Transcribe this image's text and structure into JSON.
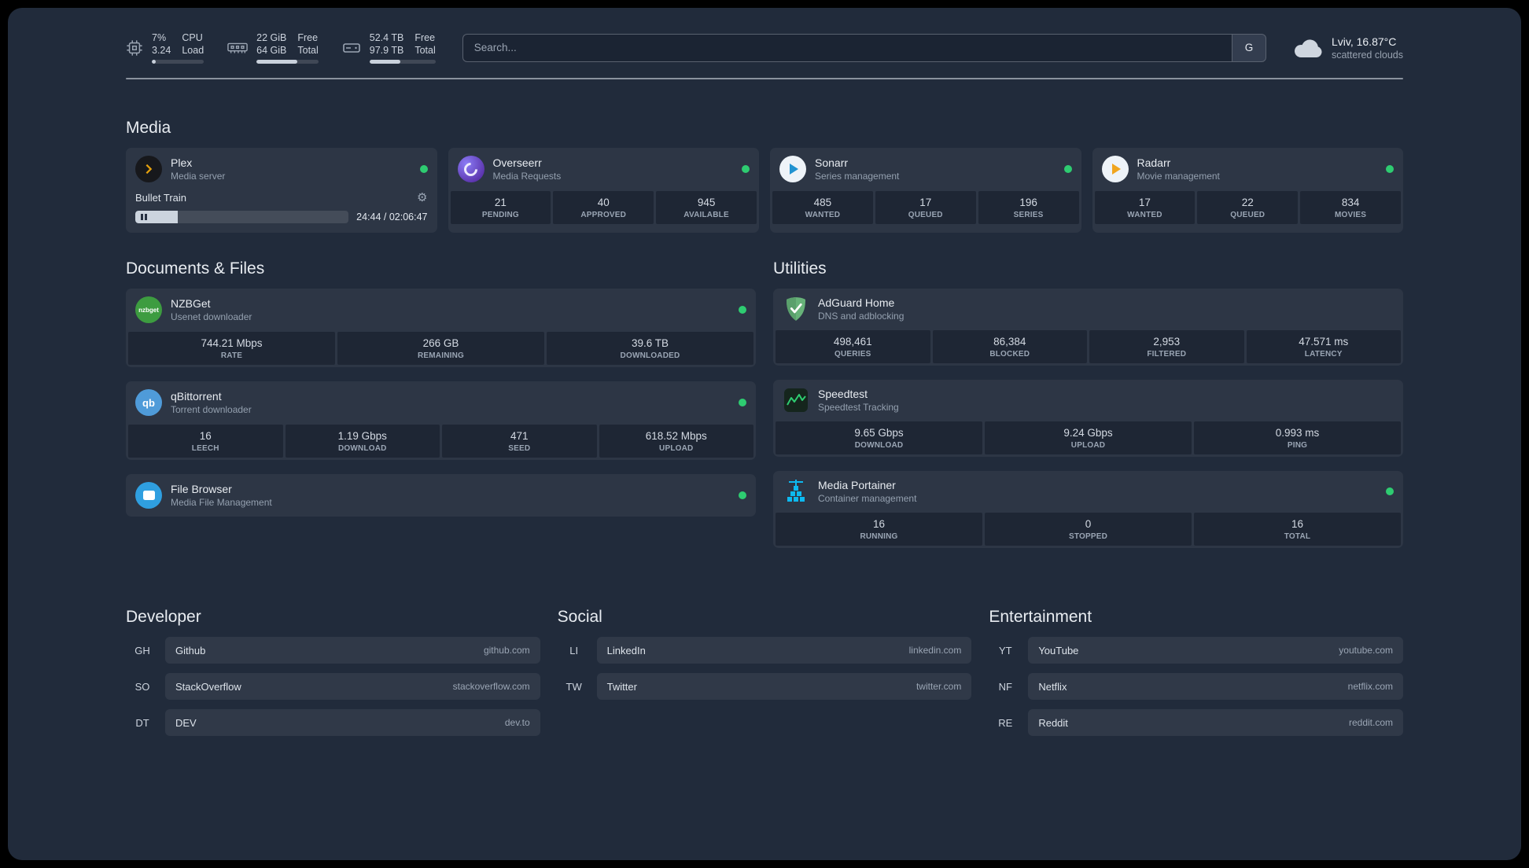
{
  "colors": {
    "status_online": "#2ecc71",
    "background": "#212b3b"
  },
  "topbar": {
    "resources": [
      {
        "icon": "cpu-icon",
        "line1_value": "7%",
        "line1_label": "CPU",
        "line2_value": "3.24",
        "line2_label": "Load",
        "bar_pct": 7
      },
      {
        "icon": "memory-icon",
        "line1_value": "22 GiB",
        "line1_label": "Free",
        "line2_value": "64 GiB",
        "line2_label": "Total",
        "bar_pct": 66
      },
      {
        "icon": "disk-icon",
        "line1_value": "52.4 TB",
        "line1_label": "Free",
        "line2_value": "97.9 TB",
        "line2_label": "Total",
        "bar_pct": 47
      }
    ],
    "search": {
      "placeholder": "Search...",
      "provider_button": "G"
    },
    "weather": {
      "location": "Lviv, 16.87°C",
      "condition": "scattered clouds"
    }
  },
  "sections": {
    "media": {
      "title": "Media",
      "plex": {
        "name": "Plex",
        "desc": "Media server",
        "now_playing": "Bullet Train",
        "time": "24:44 / 02:06:47",
        "progress_pct": 20
      },
      "overseerr": {
        "name": "Overseerr",
        "desc": "Media Requests",
        "stats": [
          {
            "value": "21",
            "label": "PENDING"
          },
          {
            "value": "40",
            "label": "APPROVED"
          },
          {
            "value": "945",
            "label": "AVAILABLE"
          }
        ]
      },
      "sonarr": {
        "name": "Sonarr",
        "desc": "Series management",
        "stats": [
          {
            "value": "485",
            "label": "WANTED"
          },
          {
            "value": "17",
            "label": "QUEUED"
          },
          {
            "value": "196",
            "label": "SERIES"
          }
        ]
      },
      "radarr": {
        "name": "Radarr",
        "desc": "Movie management",
        "stats": [
          {
            "value": "17",
            "label": "WANTED"
          },
          {
            "value": "22",
            "label": "QUEUED"
          },
          {
            "value": "834",
            "label": "MOVIES"
          }
        ]
      }
    },
    "documents": {
      "title": "Documents & Files",
      "nzbget": {
        "name": "NZBGet",
        "desc": "Usenet downloader",
        "stats": [
          {
            "value": "744.21 Mbps",
            "label": "RATE"
          },
          {
            "value": "266 GB",
            "label": "REMAINING"
          },
          {
            "value": "39.6 TB",
            "label": "DOWNLOADED"
          }
        ]
      },
      "qbittorrent": {
        "name": "qBittorrent",
        "desc": "Torrent downloader",
        "stats": [
          {
            "value": "16",
            "label": "LEECH"
          },
          {
            "value": "1.19 Gbps",
            "label": "DOWNLOAD"
          },
          {
            "value": "471",
            "label": "SEED"
          },
          {
            "value": "618.52 Mbps",
            "label": "UPLOAD"
          }
        ]
      },
      "filebrowser": {
        "name": "File Browser",
        "desc": "Media File Management"
      }
    },
    "utilities": {
      "title": "Utilities",
      "adguard": {
        "name": "AdGuard Home",
        "desc": "DNS and adblocking",
        "stats": [
          {
            "value": "498,461",
            "label": "QUERIES"
          },
          {
            "value": "86,384",
            "label": "BLOCKED"
          },
          {
            "value": "2,953",
            "label": "FILTERED"
          },
          {
            "value": "47.571 ms",
            "label": "LATENCY"
          }
        ]
      },
      "speedtest": {
        "name": "Speedtest",
        "desc": "Speedtest Tracking",
        "stats": [
          {
            "value": "9.65 Gbps",
            "label": "DOWNLOAD"
          },
          {
            "value": "9.24 Gbps",
            "label": "UPLOAD"
          },
          {
            "value": "0.993 ms",
            "label": "PING"
          }
        ]
      },
      "portainer": {
        "name": "Media Portainer",
        "desc": "Container management",
        "stats": [
          {
            "value": "16",
            "label": "RUNNING"
          },
          {
            "value": "0",
            "label": "STOPPED"
          },
          {
            "value": "16",
            "label": "TOTAL"
          }
        ]
      }
    }
  },
  "bookmarks": [
    {
      "title": "Developer",
      "items": [
        {
          "abbr": "GH",
          "name": "Github",
          "domain": "github.com"
        },
        {
          "abbr": "SO",
          "name": "StackOverflow",
          "domain": "stackoverflow.com"
        },
        {
          "abbr": "DT",
          "name": "DEV",
          "domain": "dev.to"
        }
      ]
    },
    {
      "title": "Social",
      "items": [
        {
          "abbr": "LI",
          "name": "LinkedIn",
          "domain": "linkedin.com"
        },
        {
          "abbr": "TW",
          "name": "Twitter",
          "domain": "twitter.com"
        }
      ]
    },
    {
      "title": "Entertainment",
      "items": [
        {
          "abbr": "YT",
          "name": "YouTube",
          "domain": "youtube.com"
        },
        {
          "abbr": "NF",
          "name": "Netflix",
          "domain": "netflix.com"
        },
        {
          "abbr": "RE",
          "name": "Reddit",
          "domain": "reddit.com"
        }
      ]
    }
  ],
  "icons": {
    "nzbget_text": "nzbget",
    "qbit_text": "qb",
    "gear": "⚙"
  }
}
